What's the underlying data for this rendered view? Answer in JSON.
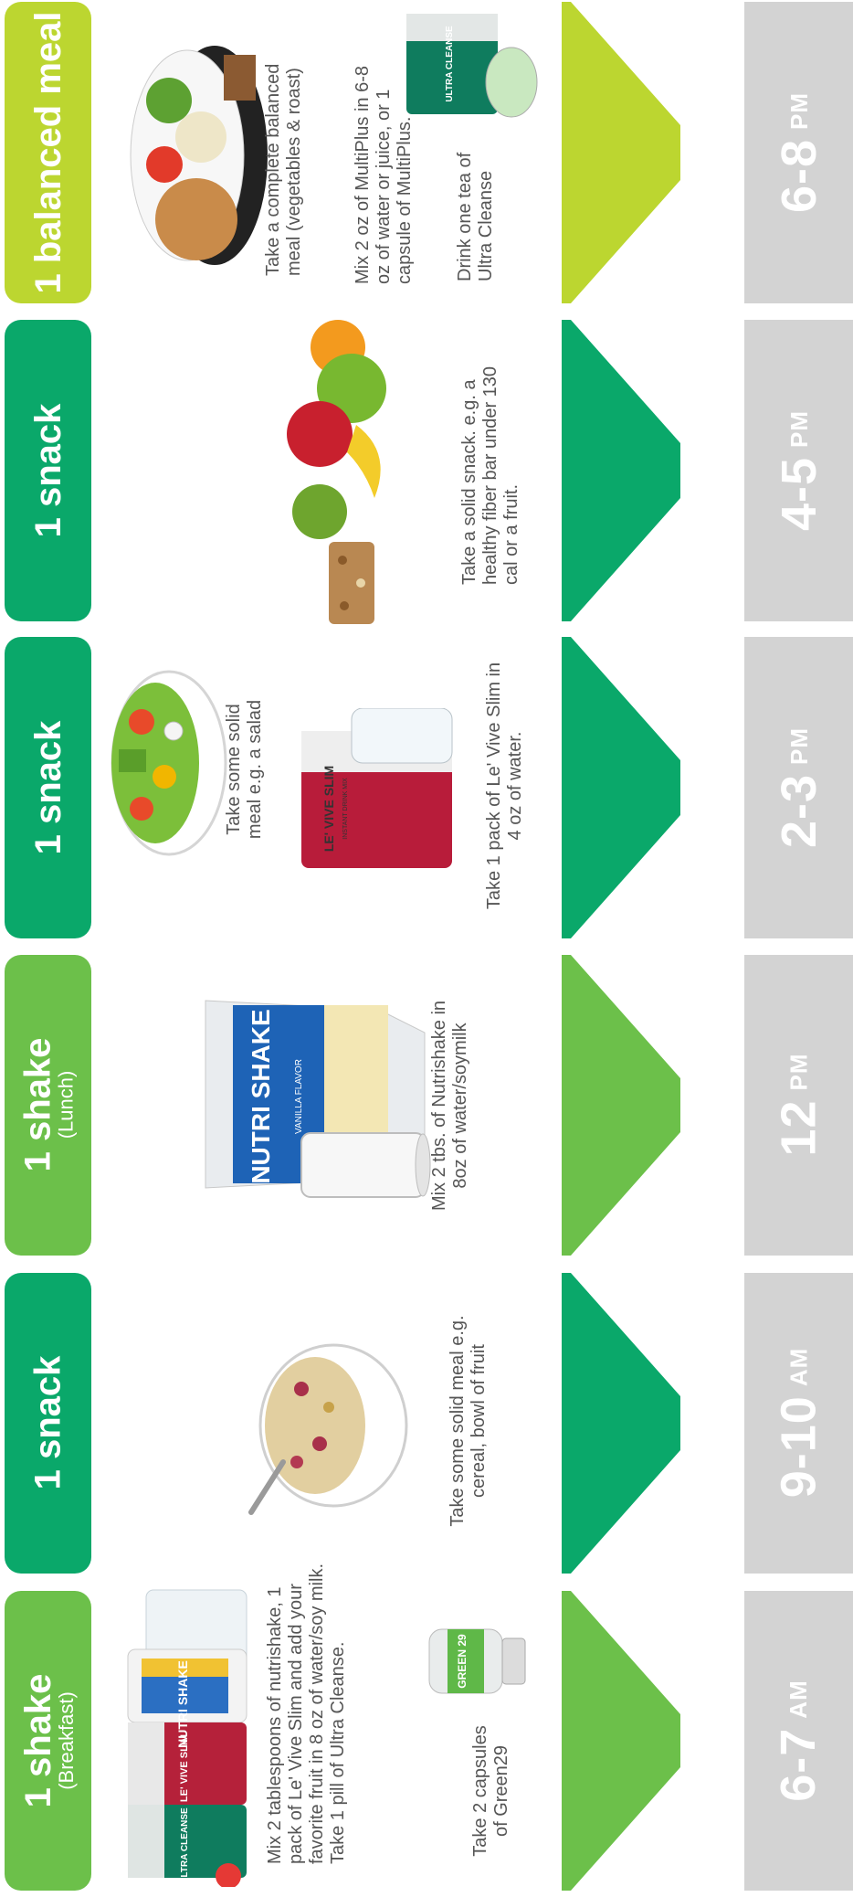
{
  "colors": {
    "dark_green": "#0aa86a",
    "light_green": "#6cc04a",
    "lime": "#bcd630",
    "time_gray": "#d3d3d3",
    "text_gray": "#555555"
  },
  "slots": [
    {
      "title": "1 shake",
      "subtitle": "(Breakfast)",
      "time": "6-7",
      "ampm": "AM",
      "desc1": "Mix 2 tablespoons of nutrishake, 1 pack of Le' Vive Slim and add your favorite fruit in 8 oz of water/soy milk. Take 1 pill of Ultra Cleanse.",
      "desc2": "Take 2 capsules of Green29",
      "images": [
        "product-bundle-image",
        "green29-bottle-image"
      ],
      "product_labels": [
        "ULTRA CLEANSE",
        "LE' VIVE SLIM",
        "NUTRI SHAKE",
        "GREEN 29"
      ]
    },
    {
      "title": "1 snack",
      "time": "9-10",
      "ampm": "AM",
      "desc1": "Take some solid meal e.g. cereal, bowl of fruit",
      "images": [
        "cereal-bowl-image"
      ]
    },
    {
      "title": "1 shake",
      "subtitle": "(Lunch)",
      "time": "12",
      "ampm": "PM",
      "desc1": "Mix 2 tbs. of Nutrishake in 8oz of  water/soymilk",
      "images": [
        "nutrishake-pack-image",
        "milk-glass-image"
      ],
      "product_labels": [
        "NUTRI SHAKE",
        "VANILLA FLAVOR"
      ]
    },
    {
      "title": "1 snack",
      "time": "2-3",
      "ampm": "PM",
      "desc1": "Take some solid meal e.g. a salad",
      "desc2": "Take 1 pack of Le' Vive Slim in 4 oz of water.",
      "images": [
        "salad-plate-image",
        "levive-slim-pack-image"
      ],
      "product_labels": [
        "LE' VIVE SLIM",
        "INSTANT DRINK MIX"
      ]
    },
    {
      "title": "1 snack",
      "time": "4-5",
      "ampm": "PM",
      "desc1": "Take a solid snack. e.g. a healthy fiber bar under 130 cal or a fruit.",
      "images": [
        "fruit-pile-image",
        "fiber-bar-image"
      ]
    },
    {
      "title": "1 balanced meal",
      "time": "6-8",
      "ampm": "PM",
      "desc1": "Take a complete balanced meal (vegetables & roast)",
      "desc2": "Mix 2 oz of MultiPlus in 6-8 oz of water or juice, or 1 capsule of MultiPlus.",
      "desc3": "Drink one tea of Ultra Cleanse",
      "images": [
        "balanced-meal-image",
        "ultra-cleanse-tea-image"
      ],
      "product_labels": [
        "ULTRA CLEANSE"
      ]
    }
  ]
}
